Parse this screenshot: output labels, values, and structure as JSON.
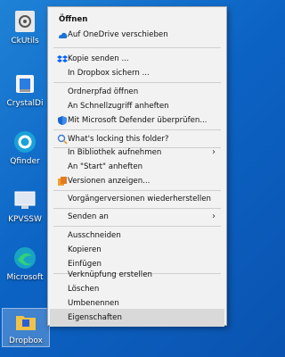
{
  "desktop": {
    "icons": [
      {
        "label": "CkUtils",
        "icon": "settings-app-icon"
      },
      {
        "label": "CrystalDi",
        "icon": "crystaldisk-icon"
      },
      {
        "label": "Qfinder",
        "icon": "qfinder-icon"
      },
      {
        "label": "KPVSSW",
        "icon": "remote-desktop-icon"
      },
      {
        "label": "Microsoft",
        "icon": "edge-icon"
      },
      {
        "label": "Dropbox",
        "icon": "folder-icon"
      }
    ]
  },
  "context_menu": {
    "items": [
      {
        "label": "Öffnen",
        "bold": true
      },
      {
        "label": "Auf OneDrive verschieben",
        "icon": "onedrive-icon"
      },
      {
        "label": "Kopie senden ...",
        "icon": "dropbox-icon"
      },
      {
        "label": "In Dropbox sichern ..."
      },
      {
        "label": "Ordnerpfad öffnen"
      },
      {
        "label": "An Schnellzugriff anheften"
      },
      {
        "label": "Mit Microsoft Defender überprüfen...",
        "icon": "defender-icon"
      },
      {
        "label": "What's locking this folder?",
        "icon": "lock-search-icon"
      },
      {
        "label": "In Bibliothek aufnehmen",
        "submenu": true
      },
      {
        "label": "An \"Start\" anheften"
      },
      {
        "label": "Versionen anzeigen...",
        "icon": "versions-icon"
      },
      {
        "label": "Vorgängerversionen wiederherstellen"
      },
      {
        "label": "Senden an",
        "submenu": true
      },
      {
        "label": "Ausschneiden"
      },
      {
        "label": "Kopieren"
      },
      {
        "label": "Einfügen"
      },
      {
        "label": "Verknüpfung erstellen"
      },
      {
        "label": "Löschen"
      },
      {
        "label": "Umbenennen"
      },
      {
        "label": "Eigenschaften",
        "highlighted": true
      }
    ],
    "submenu_arrow": "›"
  }
}
